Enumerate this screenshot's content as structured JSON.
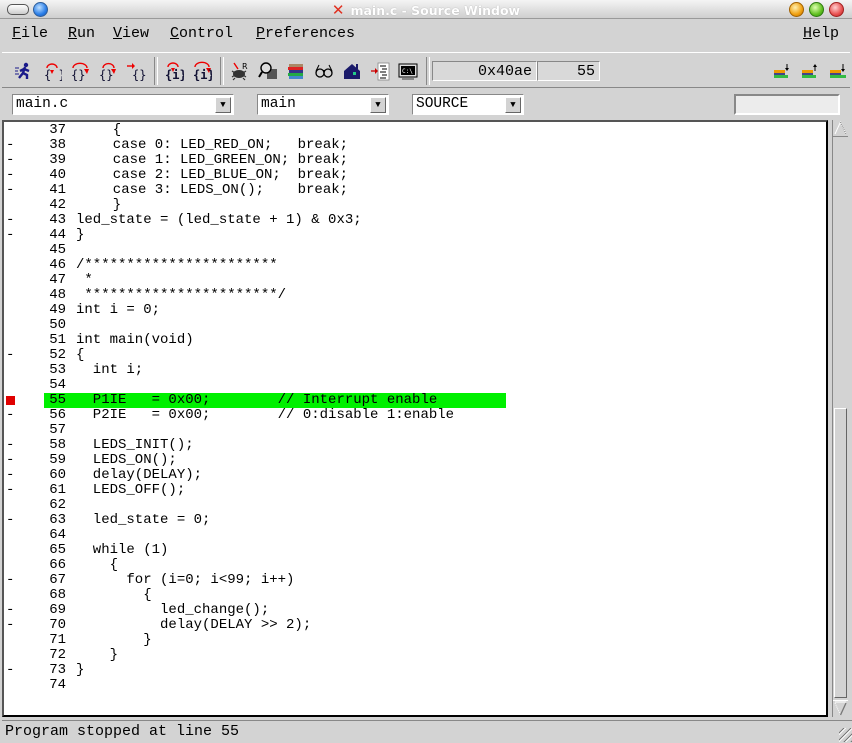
{
  "window": {
    "title": "main.c - Source Window",
    "title_icon": "x-icon"
  },
  "menubar": {
    "items": [
      {
        "label": "File",
        "mnemonic": "F",
        "rest": "ile"
      },
      {
        "label": "Run",
        "mnemonic": "R",
        "rest": "un"
      },
      {
        "label": "View",
        "mnemonic": "V",
        "rest": "iew"
      },
      {
        "label": "Control",
        "mnemonic": "C",
        "rest": "ontrol"
      },
      {
        "label": "Preferences",
        "mnemonic": "P",
        "rest": "references"
      }
    ],
    "help": {
      "label": "Help",
      "mnemonic": "H",
      "rest": "elp"
    }
  },
  "toolbar": {
    "buttons": [
      {
        "name": "run-icon",
        "glyph": "🏃"
      },
      {
        "name": "step-icon",
        "glyph": "{↓}"
      },
      {
        "name": "next-icon",
        "glyph": "{}↷"
      },
      {
        "name": "finish-icon",
        "glyph": "{}↑"
      },
      {
        "name": "continue-icon",
        "glyph": "→{}"
      },
      {
        "name": "step-asm-icon",
        "glyph": "{i}"
      },
      {
        "name": "next-asm-icon",
        "glyph": "{i}↷"
      },
      {
        "name": "registers-icon",
        "glyph": "🐞"
      },
      {
        "name": "memory-icon",
        "glyph": "🔍"
      },
      {
        "name": "stack-icon",
        "glyph": "≣"
      },
      {
        "name": "watch-icon",
        "glyph": "∞"
      },
      {
        "name": "locals-icon",
        "glyph": "⌂"
      },
      {
        "name": "breakpoints-icon",
        "glyph": "→≡"
      },
      {
        "name": "console-icon",
        "glyph": "▣"
      }
    ],
    "address": "0x40ae",
    "line": "55",
    "frame_buttons": [
      {
        "name": "frame-bottom-icon",
        "glyph": "≡↓"
      },
      {
        "name": "frame-up-icon",
        "glyph": "≡↑"
      },
      {
        "name": "frame-down-icon",
        "glyph": "≡↓"
      }
    ]
  },
  "selectors": {
    "file": "main.c",
    "function": "main",
    "mode": "SOURCE",
    "search_value": ""
  },
  "source": {
    "current_line": 55,
    "lines": [
      {
        "n": "37",
        "mark": "",
        "code": "  {"
      },
      {
        "n": "38",
        "mark": "-",
        "code": "  case 0: LED_RED_ON;   break;"
      },
      {
        "n": "39",
        "mark": "-",
        "code": "  case 1: LED_GREEN_ON; break;"
      },
      {
        "n": "40",
        "mark": "-",
        "code": "  case 2: LED_BLUE_ON;  break;"
      },
      {
        "n": "41",
        "mark": "-",
        "code": "  case 3: LEDS_ON();    break;"
      },
      {
        "n": "42",
        "mark": "",
        "code": "  }"
      },
      {
        "n": "43",
        "mark": "-",
        "code": "led_state = (led_state + 1) & 0x3;"
      },
      {
        "n": "44",
        "mark": "-",
        "code": "}"
      },
      {
        "n": "45",
        "mark": "",
        "code": ""
      },
      {
        "n": "46",
        "mark": "",
        "code": "/***********************"
      },
      {
        "n": "47",
        "mark": "",
        "code": " *"
      },
      {
        "n": "48",
        "mark": "",
        "code": " ***********************/"
      },
      {
        "n": "49",
        "mark": "",
        "code": "int i = 0;"
      },
      {
        "n": "50",
        "mark": "",
        "code": ""
      },
      {
        "n": "51",
        "mark": "",
        "code": "int main(void)"
      },
      {
        "n": "52",
        "mark": "-",
        "code": "{"
      },
      {
        "n": "53",
        "mark": "",
        "code": "  int i;"
      },
      {
        "n": "54",
        "mark": "",
        "code": ""
      },
      {
        "n": "55",
        "mark": "bp",
        "code": "  P1IE   = 0x00;        // Interrupt enable"
      },
      {
        "n": "56",
        "mark": "-",
        "code": "  P2IE   = 0x00;        // 0:disable 1:enable"
      },
      {
        "n": "57",
        "mark": "",
        "code": ""
      },
      {
        "n": "58",
        "mark": "-",
        "code": "  LEDS_INIT();"
      },
      {
        "n": "59",
        "mark": "-",
        "code": "  LEDS_ON();"
      },
      {
        "n": "60",
        "mark": "-",
        "code": "  delay(DELAY);"
      },
      {
        "n": "61",
        "mark": "-",
        "code": "  LEDS_OFF();"
      },
      {
        "n": "62",
        "mark": "",
        "code": ""
      },
      {
        "n": "63",
        "mark": "-",
        "code": "  led_state = 0;"
      },
      {
        "n": "64",
        "mark": "",
        "code": ""
      },
      {
        "n": "65",
        "mark": "",
        "code": "  while (1)"
      },
      {
        "n": "66",
        "mark": "",
        "code": "    {"
      },
      {
        "n": "67",
        "mark": "-",
        "code": "      for (i=0; i<99; i++)"
      },
      {
        "n": "68",
        "mark": "",
        "code": "        {"
      },
      {
        "n": "69",
        "mark": "-",
        "code": "          led_change();"
      },
      {
        "n": "70",
        "mark": "-",
        "code": "          delay(DELAY >> 2);"
      },
      {
        "n": "71",
        "mark": "",
        "code": "        }"
      },
      {
        "n": "72",
        "mark": "",
        "code": "    }"
      },
      {
        "n": "73",
        "mark": "-",
        "code": "}"
      },
      {
        "n": "74",
        "mark": "",
        "code": ""
      }
    ],
    "indent_prefix_37_42": "    "
  },
  "colors": {
    "highlight": "#00f000",
    "breakpoint": "#e00000"
  },
  "status": {
    "text": "Program stopped at line 55"
  }
}
